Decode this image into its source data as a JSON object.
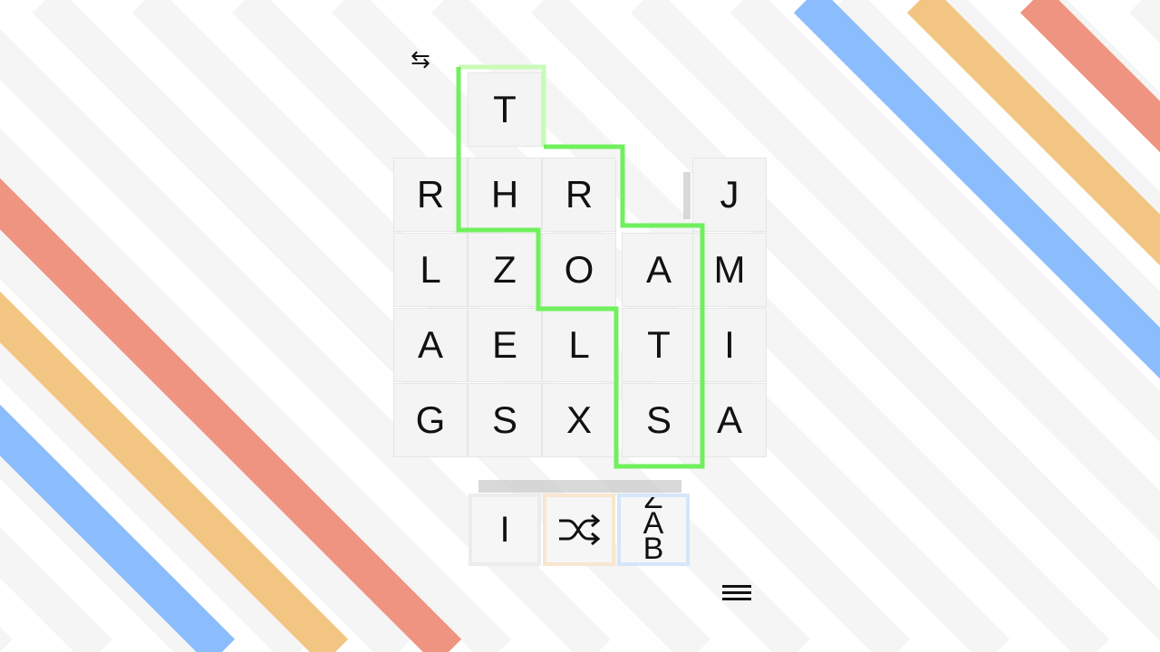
{
  "colors": {
    "stripe_red": "#ee9480",
    "stripe_orange": "#f3c582",
    "stripe_blue": "#8bbcfc",
    "stripe_grey": "#f5f5f5",
    "selection_green": "#6ff05c",
    "selection_green_light": "#c9fbb8",
    "tray_orange": "#f9e6cf",
    "tray_blue": "#d5e6fb"
  },
  "toolbar": {
    "swap_icon": "⇆",
    "menu_icon": "menu-icon"
  },
  "grid": {
    "rows": [
      [
        "",
        "T",
        "",
        "",
        ""
      ],
      [
        "R",
        "H",
        "R",
        "",
        "J"
      ],
      [
        "L",
        "Z",
        "O",
        "A",
        "M"
      ],
      [
        "A",
        "E",
        "L",
        "T",
        "I"
      ],
      [
        "G",
        "S",
        "X",
        "S",
        "A"
      ]
    ],
    "selected_path": [
      "T",
      "H",
      "R",
      "O",
      "A",
      "T",
      "S"
    ]
  },
  "tray": {
    "tile1": "I",
    "shuffle_icon": "shuffle-icon",
    "tile3_top": "Z",
    "tile3_mid": "A",
    "tile3_bot": "B"
  }
}
